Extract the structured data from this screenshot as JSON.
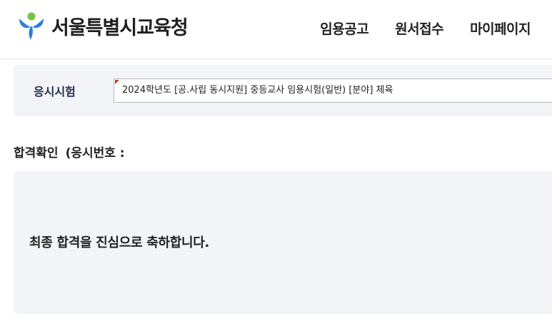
{
  "header": {
    "logo_text": "서울특별시교육청",
    "nav": [
      {
        "label": "임용공고"
      },
      {
        "label": "원서접수"
      },
      {
        "label": "마이페이지"
      }
    ]
  },
  "exam": {
    "label": "응시시험",
    "selected": "2024학년도 [공.사립 동시지원] 중등교사 임용시험(일반) [분야] 체육"
  },
  "result": {
    "title": "합격확인",
    "exam_number_label": "(응시번호 :",
    "exam_number": "",
    "message": "최종 합격을 진심으로 축하합니다."
  },
  "colors": {
    "logo_blue": "#2b7fd6",
    "logo_green": "#7bc143",
    "panel_bg": "#f3f4f8",
    "label_navy": "#1f2f4f"
  }
}
